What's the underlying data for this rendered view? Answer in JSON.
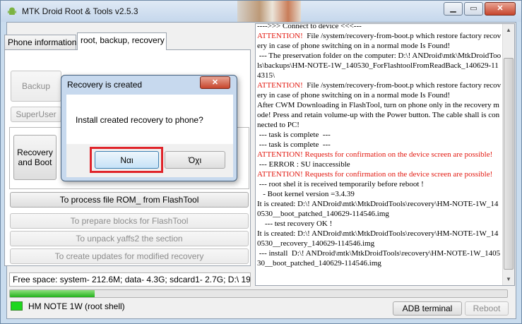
{
  "window": {
    "title": "MTK Droid Root & Tools v2.5.3",
    "min_glyph": "▁",
    "max_glyph": "▭",
    "close_glyph": "✕"
  },
  "tabs": [
    {
      "label": "Phone information",
      "active": false
    },
    {
      "label": "root, backup, recovery",
      "active": true
    }
  ],
  "buttons": {
    "backup": "Backup",
    "superuser": "SuperUser",
    "recovery_boot": "Recovery and Boot",
    "process_rom": "To process file ROM_ from FlashTool",
    "prepare_blocks": "To prepare blocks for FlashTool",
    "unpack_yaffs": "To unpack yaffs2 the section",
    "create_updates": "To create updates for modified recovery",
    "adb_terminal": "ADB terminal",
    "reboot": "Reboot"
  },
  "free_space": "Free space: system- 212.6M; data- 4.3G; sdcard1- 2.7G;  D:\\ 194055M",
  "log": [
    {
      "text": "---->>> Connect to device <<<---",
      "attention": false
    },
    {
      "text": "ATTENTION!  File /system/recovery-from-boot.p which restore factory recovery in case of phone switching on in a normal mode Is Found!",
      "attention": false,
      "prefix": "ATTENTION!"
    },
    {
      "text": " --- The preservation folder on the computer: D:\\! ANDroid\\mtk\\MtkDroidTools\\backups\\HM-NOTE-1W_140530_ForFlashtoolFromReadBack_140629-114315\\",
      "attention": false
    },
    {
      "text": "ATTENTION!  File /system/recovery-from-boot.p which restore factory recovery in case of phone switching on in a normal mode Is Found!",
      "attention": false,
      "prefix": "ATTENTION!"
    },
    {
      "text": "After CWM Downloading in FlashTool, turn on phone only in the recovery mode! Press and retain volume-up with the Power button. The cable shall is connected to PC!",
      "attention": false
    },
    {
      "text": " --- task is complete  ---",
      "attention": false
    },
    {
      "text": " --- task is complete  ---",
      "attention": false
    },
    {
      "text": "ATTENTION! Requests for confirmation on the device screen are possible!",
      "attention": true
    },
    {
      "text": " --- ERROR : SU inaccessible",
      "attention": false
    },
    {
      "text": "ATTENTION! Requests for confirmation on the device screen are possible!",
      "attention": true
    },
    {
      "text": " --- root shel it is received temporarily before reboot !",
      "attention": false
    },
    {
      "text": "   - Boot kernel version =3.4.39",
      "attention": false
    },
    {
      "text": "It is created: D:\\! ANDroid\\mtk\\MtkDroidTools\\recovery\\HM-NOTE-1W_140530__boot_patched_140629-114546.img",
      "attention": false
    },
    {
      "text": "    --- test recovery OK !",
      "attention": false
    },
    {
      "text": "It is created: D:\\! ANDroid\\mtk\\MtkDroidTools\\recovery\\HM-NOTE-1W_140530__recovery_140629-114546.img",
      "attention": false
    },
    {
      "text": " --- install  D:\\! ANDroid\\mtk\\MtkDroidTools\\recovery\\HM-NOTE-1W_140530__boot_patched_140629-114546.img",
      "attention": false
    }
  ],
  "progress": {
    "value": 0.17
  },
  "status": {
    "device": "HM NOTE 1W (root shell)",
    "device_color": "#1ed71e"
  },
  "dialog": {
    "title": "Recovery is created",
    "message": "Install created recovery to phone?",
    "yes_label": "Ναι",
    "no_label": "Όχι",
    "close_glyph": "✕"
  },
  "colors": {
    "attention": "#e2170e",
    "highlight": "#e0242a"
  }
}
